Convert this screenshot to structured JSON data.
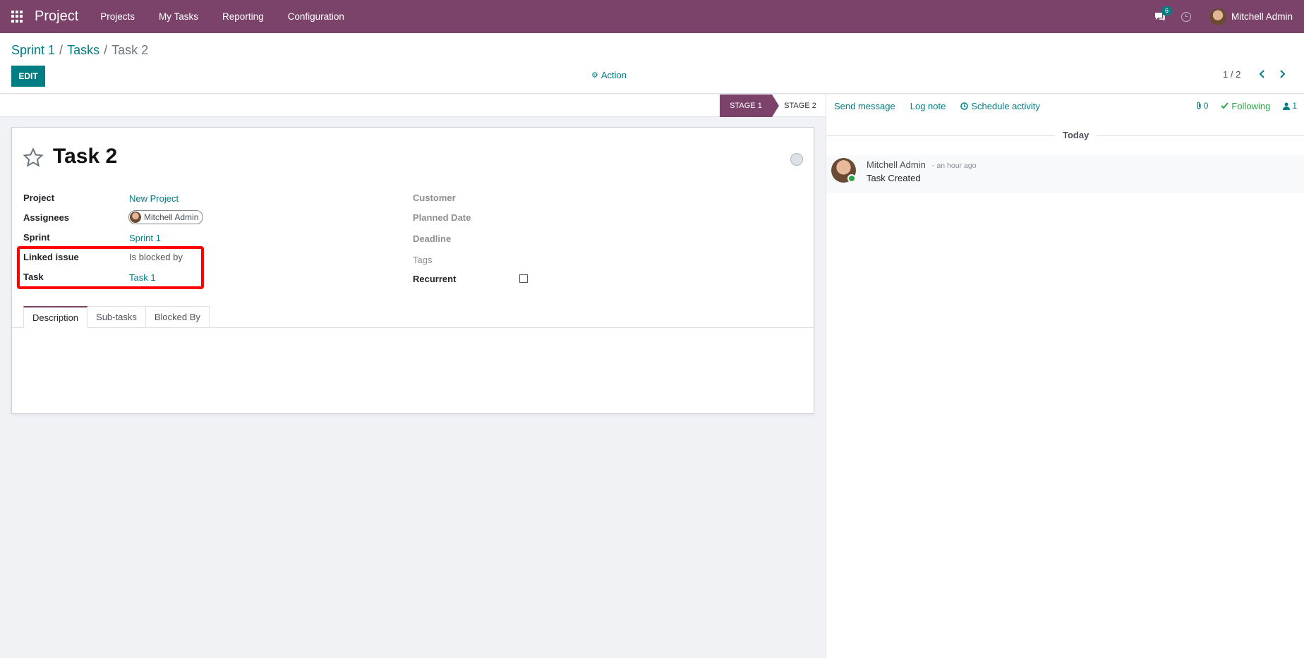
{
  "navbar": {
    "brand": "Project",
    "menu": [
      "Projects",
      "My Tasks",
      "Reporting",
      "Configuration"
    ],
    "chat_badge": "6",
    "user_name": "Mitchell Admin"
  },
  "control_panel": {
    "breadcrumb": {
      "items": [
        "Sprint 1",
        "Tasks"
      ],
      "separator": "/",
      "current": "Task 2"
    },
    "edit_label": "EDIT",
    "action_label": "Action",
    "pager": "1 / 2"
  },
  "statusbar": {
    "stages": [
      "STAGE 1",
      "STAGE 2"
    ],
    "active_stage": "STAGE 1"
  },
  "form": {
    "title": "Task 2",
    "left_fields": {
      "project": {
        "label": "Project",
        "value": "New Project"
      },
      "assignees": {
        "label": "Assignees",
        "value": "Mitchell Admin"
      },
      "sprint": {
        "label": "Sprint",
        "value": "Sprint 1"
      },
      "linked_issue": {
        "label": "Linked issue",
        "value": "Is blocked by"
      },
      "task": {
        "label": "Task",
        "value": "Task 1"
      }
    },
    "right_fields": {
      "customer": {
        "label": "Customer"
      },
      "planned_date": {
        "label": "Planned Date"
      },
      "deadline": {
        "label": "Deadline"
      },
      "tags": {
        "label": "Tags"
      },
      "recurrent": {
        "label": "Recurrent",
        "checked": false
      }
    },
    "tabs": [
      "Description",
      "Sub-tasks",
      "Blocked By"
    ],
    "active_tab": "Description"
  },
  "chatter": {
    "send_message": "Send message",
    "log_note": "Log note",
    "schedule_activity": "Schedule activity",
    "attachments_count": "0",
    "following_label": "Following",
    "followers_count": "1",
    "date_separator": "Today",
    "messages": [
      {
        "author": "Mitchell Admin",
        "time": "- an hour ago",
        "body": "Task Created"
      }
    ]
  },
  "colors": {
    "brand": "#7b4369",
    "accent": "#017e84",
    "following": "#28a745",
    "highlight": "#ff0000"
  }
}
